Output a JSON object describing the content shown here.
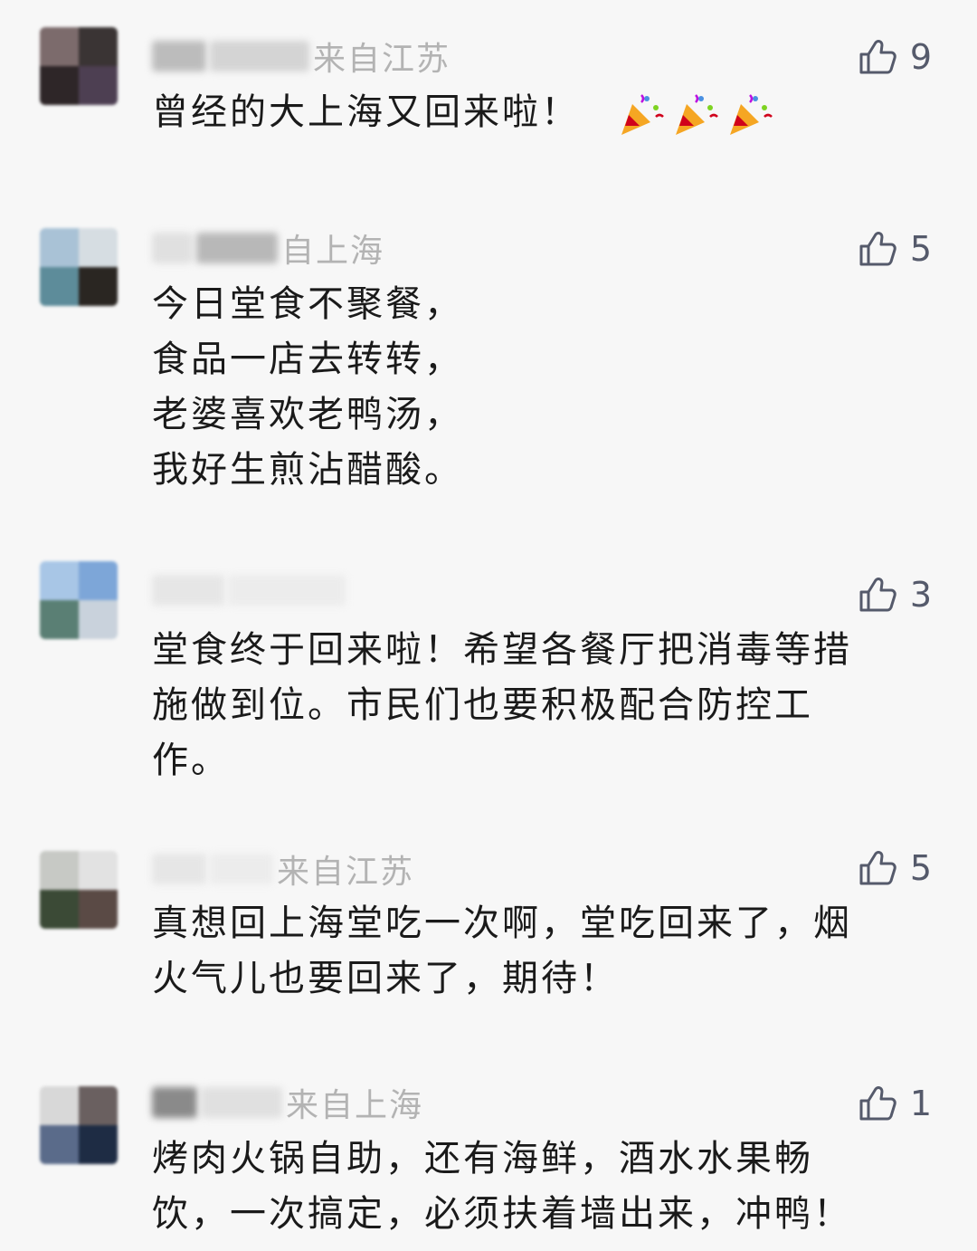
{
  "comments": [
    {
      "location": "来自江苏",
      "likes": "9",
      "lines": [
        "曾经的大上海又回来啦！"
      ],
      "emoji": [
        "party-popper-icon",
        "party-popper-icon",
        "party-popper-icon"
      ]
    },
    {
      "location": "自上海",
      "likes": "5",
      "lines": [
        "今日堂食不聚餐，",
        "食品一店去转转，",
        "老婆喜欢老鸭汤，",
        "我好生煎沾醋酸。"
      ]
    },
    {
      "location": "",
      "likes": "3",
      "lines": [
        "堂食终于回来啦！希望各餐厅把消毒等措",
        "施做到位。市民们也要积极配合防控工",
        "作。"
      ]
    },
    {
      "location": "来自江苏",
      "likes": "5",
      "lines": [
        "真想回上海堂吃一次啊，堂吃回来了，烟",
        "火气儿也要回来了，期待！"
      ]
    },
    {
      "location": "来自上海",
      "likes": "1",
      "lines": [
        "烤肉火锅自助，还有海鲜，酒水水果畅",
        "饮，一次搞定，必须扶着墙出来，冲鸭！"
      ]
    }
  ],
  "icons": {
    "like": "thumbs-up-icon",
    "emoji": "party-popper-icon"
  },
  "colors": {
    "background": "#f7f7f7",
    "text": "#1a1a1a",
    "meta": "#b3b3b3",
    "like": "#555a6b"
  }
}
